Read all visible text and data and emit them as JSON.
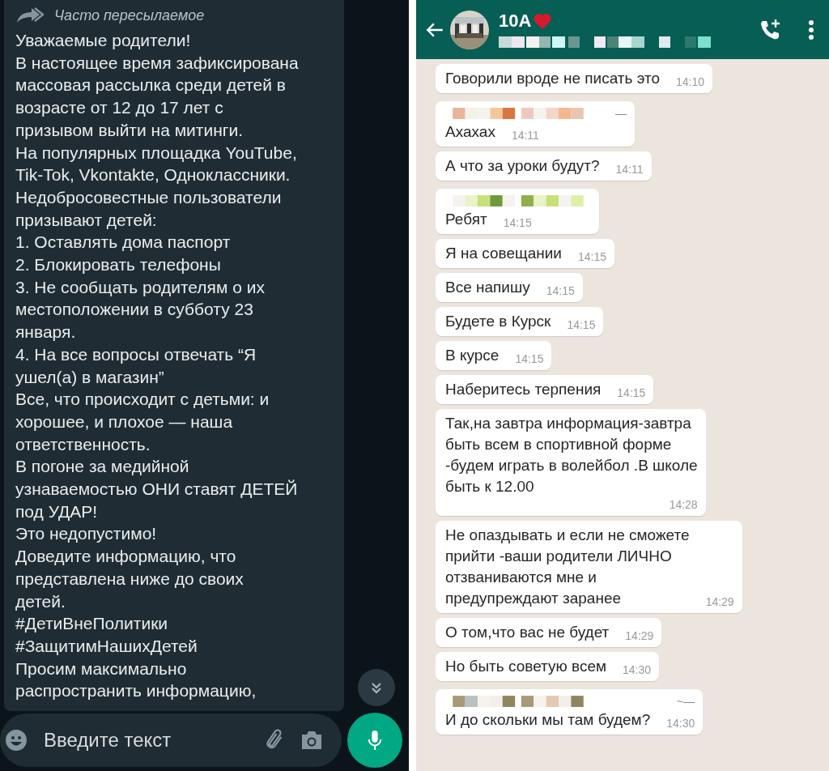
{
  "left_chat": {
    "forwarded_label": "Часто пересылаемое",
    "message": "Уважаемые родители!\nВ настоящее время зафиксирована\nмассовая рассылка среди детей в\nвозрасте от 12 до 17 лет с\nпризывом выйти на митинги.\nНа популярных площадка YouTube,\nTik-Tok, Vkontakte, Одноклассники.\nНедобросовестные пользователи\nпризывают детей:\n1. Оставлять дома паспорт\n2. Блокировать телефоны\n3. Не сообщать родителям о их\nместоположении в субботу 23\nянваря.\n4. На все вопросы отвечать “Я\nушел(а) в магазин”\nВсе, что происходит с детьми: и\nхорошее, и плохое — наша\nответственность.\nВ погоне за медийной\nузнаваемостью ОНИ ставят ДЕТЕЙ\nпод УДАР!\nЭто недопустимо!\nДоведите информацию, что\nпредставлена ниже до своих\nдетей.\n#ДетиВнеПолитики\n#ЗащитимНашихДетей\nПросим максимально\nраспространить информацию,",
    "composer": {
      "placeholder": "Введите текст"
    }
  },
  "right_chat": {
    "header": {
      "title": "10А"
    },
    "messages": [
      {
        "text": "Говорили вроде не писать это",
        "time": "14:10"
      },
      {
        "sender": true,
        "sender_mark": "—",
        "text": "Ахахах",
        "time": "14:11"
      },
      {
        "text": "А что за уроки будут?",
        "time": "14:11"
      },
      {
        "sender": true,
        "text": "Ребят",
        "time": "14:15"
      },
      {
        "text": "Я на совещании",
        "time": "14:15"
      },
      {
        "text": "Все напишу",
        "time": "14:15"
      },
      {
        "text": "Будете в Курск",
        "time": "14:15"
      },
      {
        "text": "В курсе",
        "time": "14:15"
      },
      {
        "text": "Наберитесь терпения",
        "time": "14:15"
      },
      {
        "text": "Так,на завтра информация-завтра\nбыть всем в спортивной форме\n-будем играть в волейбол .В школе\nбыть к 12.00",
        "time": "14:28",
        "time_own_line": true
      },
      {
        "text": "Не опаздывать и если не сможете\nприйти -ваши родители ЛИЧНО\nотзваниваются мне и\nпредупреждают заранее",
        "time": "14:29"
      },
      {
        "text": "О том,что вас не будет",
        "time": "14:29"
      },
      {
        "text": "Но быть советую всем",
        "time": "14:30"
      },
      {
        "sender": true,
        "sender_mark": "~—",
        "text": "И до скольки мы там будем?",
        "time": "14:30"
      }
    ]
  }
}
